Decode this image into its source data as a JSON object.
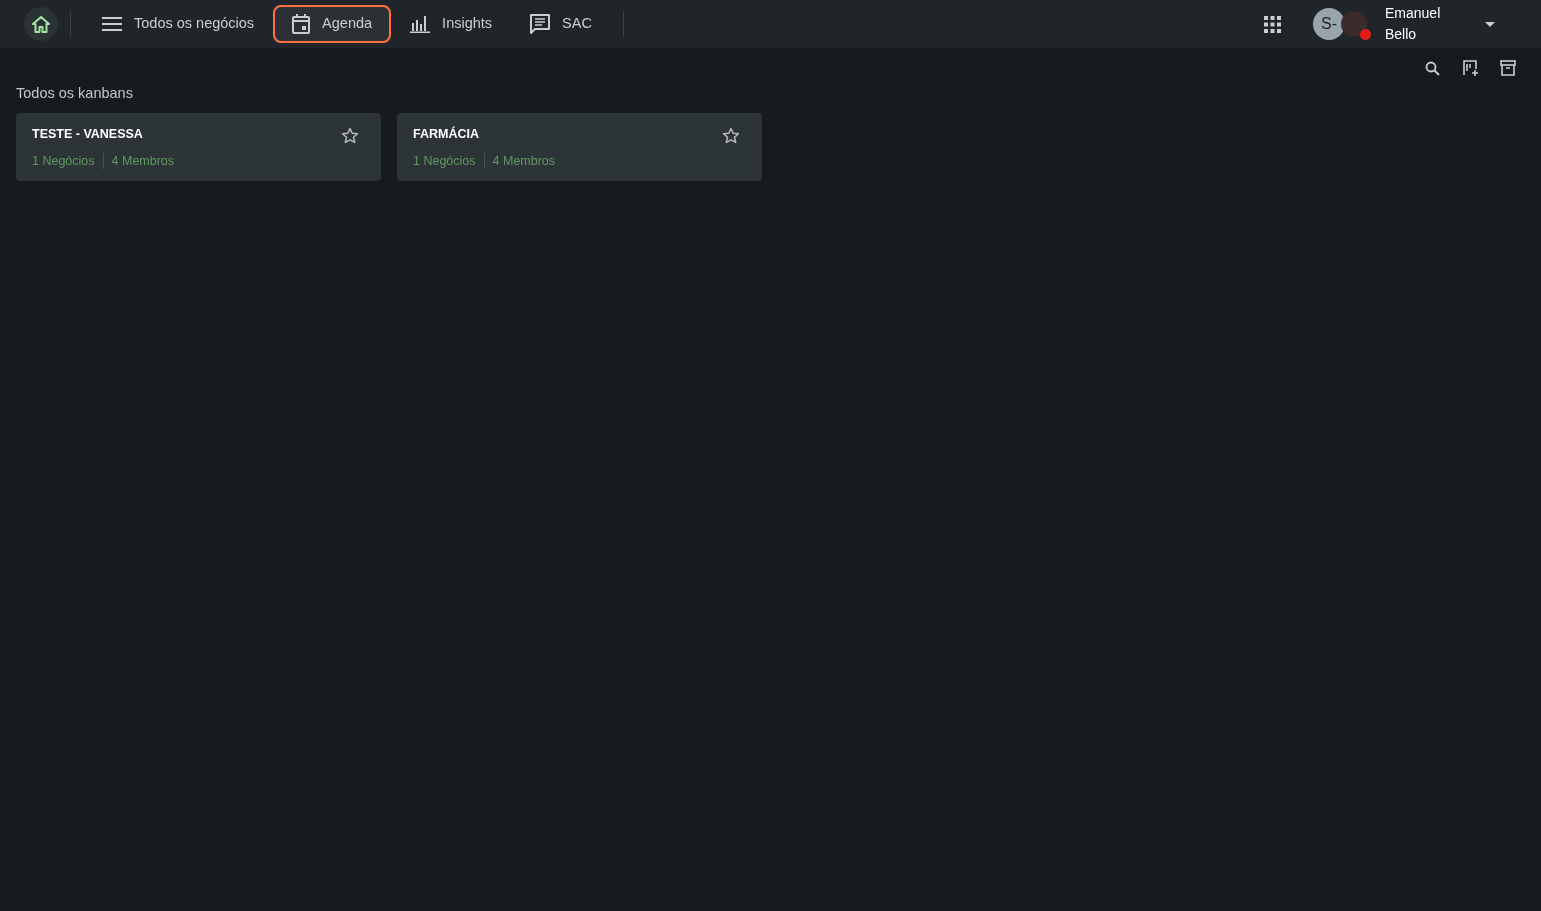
{
  "nav": {
    "items": [
      {
        "kind": "home",
        "selected": false
      },
      {
        "kind": "menu",
        "label": "Todos os negócios",
        "selected": false
      },
      {
        "kind": "calendar",
        "label": "Agenda",
        "selected": true
      },
      {
        "kind": "chart",
        "label": "Insights",
        "selected": false
      },
      {
        "kind": "chat",
        "label": "SAC",
        "selected": false
      }
    ]
  },
  "user": {
    "initials": "S-",
    "name": "Emanuel Bello",
    "busy": true
  },
  "toolbar": {
    "actions": [
      {
        "kind": "search"
      },
      {
        "kind": "add-board"
      },
      {
        "kind": "archive"
      }
    ]
  },
  "section_title": "Todos os kanbans",
  "boards": [
    {
      "title": "TESTE - VANESSA",
      "deals": "1 Negócios",
      "members": "4 Membros",
      "favorite": false
    },
    {
      "title": "FARMÁCIA",
      "deals": "1 Negócios",
      "members": "4 Membros",
      "favorite": false
    }
  ]
}
